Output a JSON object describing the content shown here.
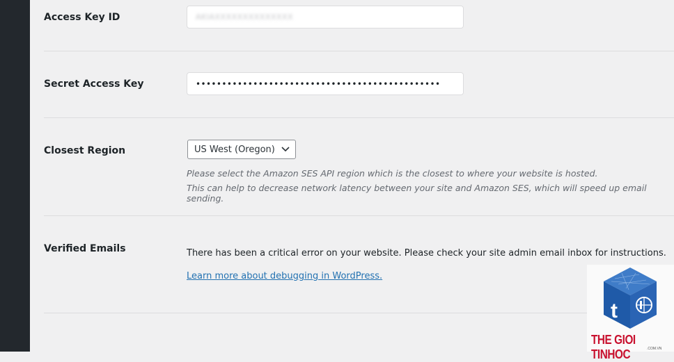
{
  "fields": {
    "access_key": {
      "label": "Access Key ID",
      "value": "AKIAXXXXXXXXXXXXXX"
    },
    "secret_key": {
      "label": "Secret Access Key",
      "value": "•••••••••••••••••••••••••••••••••••••••••••••••"
    },
    "region": {
      "label": "Closest Region",
      "selected": "US West (Oregon)",
      "description_1": "Please select the Amazon SES API region which is the closest to where your website is hosted.",
      "description_2": "This can help to decrease network latency between your site and Amazon SES, which will speed up email sending."
    },
    "verified": {
      "label": "Verified Emails",
      "error_message": "There has been a critical error on your website. Please check your site admin email inbox for instructions.",
      "link_text": "Learn more about debugging in WordPress."
    }
  },
  "watermark": {
    "brand": "THE GIOI TINHOC",
    "domain": ".COM.VN"
  },
  "colors": {
    "sidebar": "#23282d",
    "link": "#2271b1",
    "brand_red": "#c8102e",
    "brand_blue": "#2a64b4"
  }
}
